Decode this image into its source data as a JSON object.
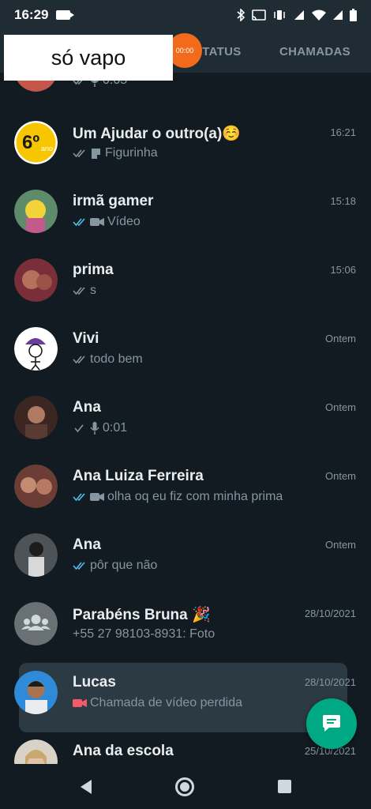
{
  "status_bar": {
    "time": "16:29"
  },
  "tabs": {
    "status": "STATUS",
    "calls": "CHAMADAS"
  },
  "recording_badge": "00:00",
  "overlay_label": "só vapo",
  "chats": [
    {
      "name": "",
      "preview": "0:05",
      "time": "",
      "tick": "grey",
      "icon": "mic-icon"
    },
    {
      "name": "Um Ajudar o outro(a)☺️",
      "preview": "Figurinha",
      "time": "16:21",
      "tick": "grey",
      "icon": "sticker-icon"
    },
    {
      "name": "irmã gamer",
      "preview": "Vídeo",
      "time": "15:18",
      "tick": "blue",
      "icon": "video-icon"
    },
    {
      "name": "prima",
      "preview": "s",
      "time": "15:06",
      "tick": "grey",
      "icon": ""
    },
    {
      "name": "Vivi",
      "preview": "todo bem",
      "time": "Ontem",
      "tick": "grey",
      "icon": ""
    },
    {
      "name": "Ana",
      "preview": "0:01",
      "time": "Ontem",
      "tick": "single",
      "icon": "mic-icon"
    },
    {
      "name": "Ana Luiza Ferreira",
      "preview": "olha oq eu fiz com minha prima",
      "time": "Ontem",
      "tick": "blue",
      "icon": "video-icon"
    },
    {
      "name": "Ana",
      "preview": "pôr que não",
      "time": "Ontem",
      "tick": "blue",
      "icon": ""
    },
    {
      "name": "Parabéns Bruna 🎉",
      "preview": "+55 27 98103-8931: Foto",
      "time": "28/10/2021",
      "tick": "",
      "icon": "photo-icon"
    },
    {
      "name": "Lucas",
      "preview": "Chamada de vídeo perdida",
      "time": "28/10/2021",
      "tick": "",
      "icon": "missed-video-icon"
    },
    {
      "name": "Ana da escola",
      "preview": "",
      "time": "25/10/2021",
      "tick": "",
      "icon": ""
    }
  ],
  "colors": {
    "accent": "#00a884",
    "tick_blue": "#53bdeb",
    "missed": "#f15c6d",
    "background": "#121b22"
  }
}
